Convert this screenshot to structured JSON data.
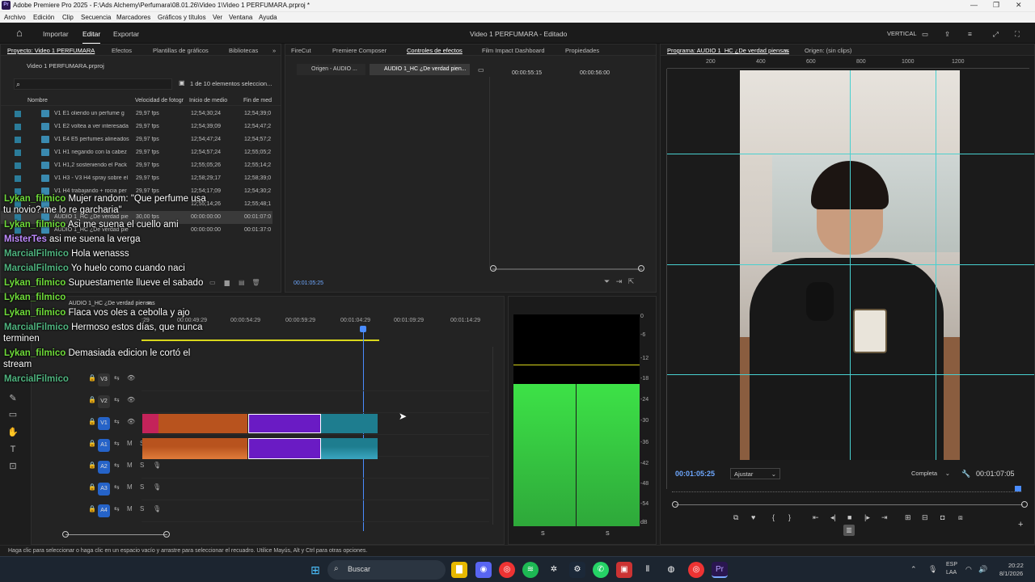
{
  "app": {
    "title": "Adobe Premiere Pro 2025 - F:\\Ads Alchemy\\Perfumara\\08.01.26\\Video 1\\Video 1 PERFUMARA.prproj *",
    "logo": "Pr"
  },
  "menu": [
    "Archivo",
    "Edición",
    "Clip",
    "Secuencia",
    "Marcadores",
    "Gráficos y títulos",
    "Ver",
    "Ventana",
    "Ayuda"
  ],
  "nav": {
    "home_icon": "home-icon",
    "importar": "Importar",
    "editar": "Editar",
    "exportar": "Exportar",
    "center": "Video 1 PERFUMARA - Editado",
    "vertical": "VERTICAL"
  },
  "project": {
    "tabs": [
      "Proyecto: Video 1 PERFUMARA",
      "Efectos",
      "Plantillas de gráficos",
      "Bibliotecas"
    ],
    "file": "Video 1 PERFUMARA.prproj",
    "count": "1 de 10 elementos seleccion...",
    "cols": [
      "Nombre",
      "Velocidad de fotogr",
      "Inicio de medio",
      "Fin de med"
    ],
    "rows": [
      {
        "name": "V1 E1 oliendo un perfume g",
        "fps": "29,97 fps",
        "start": "12;54;30;24",
        "end": "12;54;39;0"
      },
      {
        "name": "V1 E2 voltea a ver interesada",
        "fps": "29,97 fps",
        "start": "12;54;39;09",
        "end": "12;54;47;2"
      },
      {
        "name": "V1 E4 E5 perfumes alineados",
        "fps": "29,97 fps",
        "start": "12;54;47;24",
        "end": "12;54;57;2"
      },
      {
        "name": "V1 H1 negando con la cabez",
        "fps": "29,97 fps",
        "start": "12;54;57;24",
        "end": "12;55;05;2"
      },
      {
        "name": "V1 H1,2 sosteniendo el Pack",
        "fps": "29,97 fps",
        "start": "12;55;05;26",
        "end": "12;55;14;2"
      },
      {
        "name": "V1 H3 - V3 H4 spray sobre el",
        "fps": "29,97 fps",
        "start": "12;58;29;17",
        "end": "12;58;39;0"
      },
      {
        "name": "V1 H4 trabajando + rocia per",
        "fps": "29,97 fps",
        "start": "12;54;17;09",
        "end": "12;54;30;2"
      },
      {
        "name": "",
        "fps": "",
        "start": "12;55;14;26",
        "end": "12;55;48;1"
      },
      {
        "name": "AUDIO 1_HC ¿De verdad pie",
        "fps": "30,00 fps",
        "start": "00:00:00:00",
        "end": "00:01:07:0"
      },
      {
        "name": "AUDIO 1_HC ¿De verdad pie",
        "fps": "",
        "start": "00:00:00:00",
        "end": "00:01:37:0"
      }
    ]
  },
  "effects": {
    "tabs": [
      "FireCut",
      "Premiere Composer",
      "Controles de efectos",
      "Film Impact Dashboard",
      "Propiedades"
    ],
    "subtab1": "Origen - AUDIO ...",
    "subtab2": "AUDIO 1_HC ¿De verdad pien...",
    "t1": "00:00:55:15",
    "t2": "00:00:56:00",
    "timecode": "00:01:05:25"
  },
  "program": {
    "tab": "Programa: AUDIO 1_HC ¿De verdad piensas",
    "origin": "Origen: (sin clips)",
    "ruler": [
      "200",
      "400",
      "600",
      "800",
      "1000",
      "1200"
    ],
    "timecode": "00:01:05:25",
    "fit": "Ajustar",
    "quality": "Completa",
    "duration": "00:01:07:05"
  },
  "timeline": {
    "seq": "AUDIO 1_HC ¿De verdad piensas",
    "ruler": [
      ":29",
      "00:00:49:29",
      "00:00:54:29",
      "00:00:59:29",
      "00:01:04:29",
      "00:01:09:29",
      "00:01:14:29"
    ],
    "tracks": [
      {
        "n": "V3",
        "t": "v"
      },
      {
        "n": "V2",
        "t": "v"
      },
      {
        "n": "V1",
        "t": "v"
      },
      {
        "n": "A1",
        "t": "a"
      },
      {
        "n": "A2",
        "t": "a"
      },
      {
        "n": "A3",
        "t": "a"
      },
      {
        "n": "A4",
        "t": "a"
      }
    ]
  },
  "meter": {
    "labels": [
      "0",
      "-6",
      "-12",
      "-18",
      "-24",
      "-30",
      "-36",
      "-42",
      "-48",
      "-54",
      "dB"
    ],
    "ss": [
      "S",
      "S"
    ]
  },
  "chat": [
    {
      "user": "Lykan_filmico",
      "color": "#6fdc3a",
      "msg": "Mujer random: \"Que perfume usa"
    },
    {
      "user": "",
      "color": "#fff",
      "msg": "tu novio? me lo re garcharia\""
    },
    {
      "user": "Lykan_filmico",
      "color": "#6fdc3a",
      "msg": "Asi me suena el cuello ami"
    },
    {
      "user": "MisterTes",
      "color": "#c08bff",
      "msg": "asi me suena la verga"
    },
    {
      "user": "MarcialFilmico",
      "color": "#4fb47f",
      "msg": "Hola wenasss"
    },
    {
      "user": "MarcialFilmico",
      "color": "#4fb47f",
      "msg": "Yo huelo como cuando naci"
    },
    {
      "user": "Lykan_filmico",
      "color": "#6fdc3a",
      "msg": "Supuestamente llueve el sabado"
    },
    {
      "user": "Lykan_filmico",
      "color": "#6fdc3a",
      "msg": ""
    },
    {
      "user": "Lykan_filmico",
      "color": "#6fdc3a",
      "msg": "Flaca vos oles a cebolla y ajo"
    },
    {
      "user": "MarcialFilmico",
      "color": "#4fb47f",
      "msg": "Hermoso estos días, que nunca"
    },
    {
      "user": "",
      "color": "#fff",
      "msg": "terminen"
    },
    {
      "user": "Lykan_filmico",
      "color": "#6fdc3a",
      "msg": "Demasiada edicion le cortó el"
    },
    {
      "user": "",
      "color": "#fff",
      "msg": "stream"
    },
    {
      "user": "MarcialFilmico",
      "color": "#4fb47f",
      "msg": ""
    }
  ],
  "status": "Haga clic para seleccionar o haga clic en un espacio vacío y arrastre para seleccionar el recuadro. Utilice Mayús, Alt y Ctrl para otras opciones.",
  "taskbar": {
    "search": "Buscar",
    "lang1": "ESP",
    "lang2": "LAA",
    "time": "20:22",
    "date": "8/1/2026"
  }
}
